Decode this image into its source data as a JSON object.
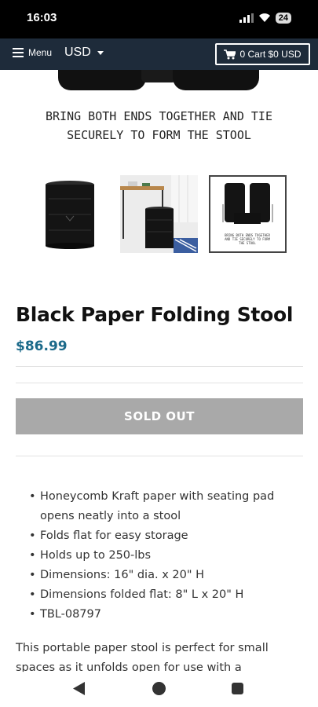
{
  "status_bar": {
    "time": "16:03",
    "battery": "24"
  },
  "header": {
    "menu_label": "Menu",
    "currency": "USD",
    "cart_label": "0 Cart $0 USD"
  },
  "hero": {
    "caption_line1": "BRING BOTH ENDS TOGETHER AND TIE",
    "caption_line2": "SECURELY TO FORM THE STOOL"
  },
  "gallery": {
    "thumb3_caption": "BRING BOTH ENDS TOGETHER AND TIE SECURELY TO FORM THE STOOL"
  },
  "product": {
    "title": "Black Paper Folding Stool",
    "price": "$86.99",
    "button_label": "SOLD OUT",
    "features": [
      "Honeycomb Kraft paper with seating pad opens neatly into a stool",
      "Folds flat for easy storage",
      "Holds up to 250-lbs",
      "Dimensions: 16\" dia. x 20\" H",
      "Dimensions folded flat: 8\" L x 20\" H",
      "TBL-08797"
    ],
    "description": "This portable paper stool is perfect for small spaces as it unfolds open for use with a"
  },
  "colors": {
    "navbar": "#1e2b3a",
    "price": "#1c6a8a",
    "sold_out_bg": "#a9a9a9"
  }
}
